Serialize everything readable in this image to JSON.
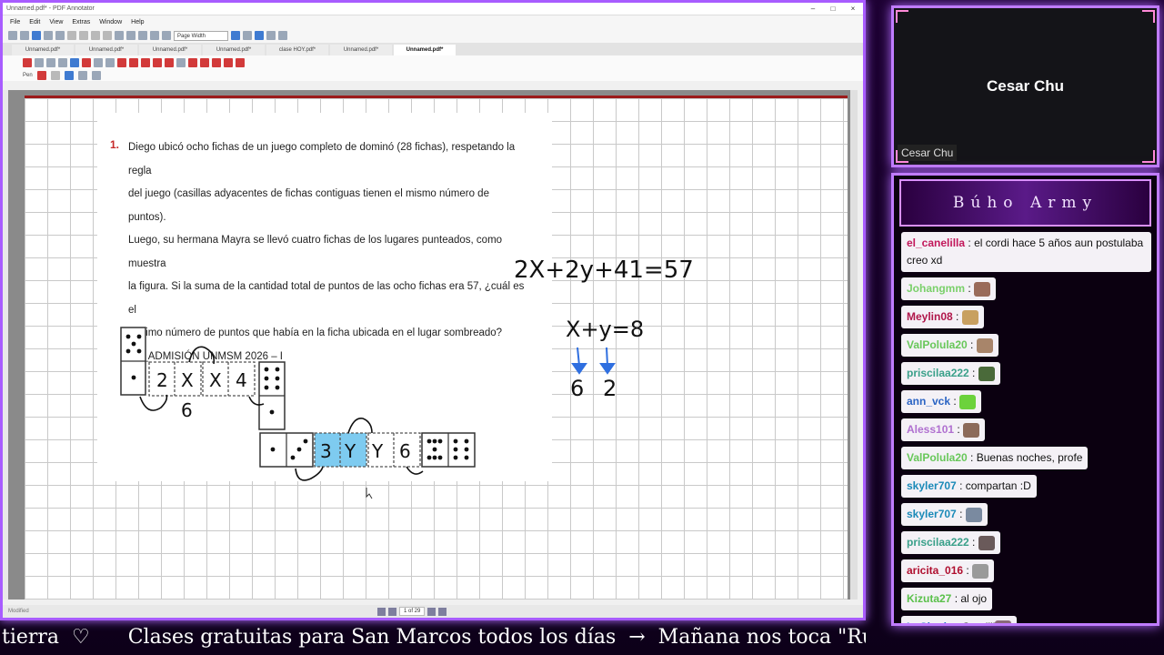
{
  "window": {
    "title": "Unnamed.pdf* - PDF Annotator",
    "controls": [
      "–",
      "□",
      "×"
    ]
  },
  "menu": [
    "File",
    "Edit",
    "View",
    "Extras",
    "Window",
    "Help"
  ],
  "zoom": "Page Width",
  "tabs": [
    "Unnamed.pdf*",
    "Unnamed.pdf*",
    "Unnamed.pdf*",
    "Unnamed.pdf*",
    "clase HOY.pdf*",
    "Unnamed.pdf*",
    "Unnamed.pdf*"
  ],
  "active_tab_index": 6,
  "pen_label": "Pen",
  "problem": {
    "number": "1.",
    "lines": [
      "Diego ubicó ocho fichas de un juego completo de dominó (28 fichas), respetando la regla",
      "del juego (casillas adyacentes de fichas contiguas tienen el mismo número de puntos).",
      "Luego, su hermana Mayra se llevó cuatro fichas de los lugares punteados, como muestra",
      "la figura. Si la suma de la cantidad total de puntos de las ocho fichas era 57, ¿cuál es el",
      "mínimo número de puntos que había en la ficha ubicada en el lugar sombreado?",
      "EX_ADMISIÓN UNMSM 2026 – I"
    ]
  },
  "handwriting": {
    "eq1": "2X+2y+41=57",
    "eq2": "X+y=8",
    "ans_left": "6",
    "ans_right": "2",
    "dom_labels": [
      "2",
      "X",
      "X",
      "4",
      "6",
      "3",
      "Y",
      "Y",
      "6"
    ]
  },
  "statusbar": {
    "left": "Modified",
    "page": "1 of 29"
  },
  "webcam": {
    "name": "Cesar Chu",
    "label": "Cesar Chu"
  },
  "chat": {
    "title": "Búho Army",
    "messages": [
      {
        "user": "el_canelilla",
        "color": "#c2185b",
        "text": "el cordi hace 5 años aun postulaba creo xd",
        "emote": ""
      },
      {
        "user": "Johangmm",
        "color": "#7ad06a",
        "text": "",
        "emote": "#9a6b5a"
      },
      {
        "user": "Meylin08",
        "color": "#b0164a",
        "text": "",
        "emote": "#c8a060"
      },
      {
        "user": "ValPolula20",
        "color": "#68c75a",
        "text": "",
        "emote": "#a8856a"
      },
      {
        "user": "priscilaa222",
        "color": "#3aa08a",
        "text": "",
        "emote": "#4a6a3a"
      },
      {
        "user": "ann_vck",
        "color": "#2b64c4",
        "text": "",
        "emote": "#6cd23c"
      },
      {
        "user": "Aless101",
        "color": "#b070d0",
        "text": "",
        "emote": "#8c6a5a"
      },
      {
        "user": "ValPolula20",
        "color": "#68c75a",
        "text": "Buenas noches, profe",
        "emote": ""
      },
      {
        "user": "skyler707",
        "color": "#1b8ab8",
        "text": "compartan :D",
        "emote": ""
      },
      {
        "user": "skyler707",
        "color": "#1b8ab8",
        "text": "",
        "emote": "#7a8aa0"
      },
      {
        "user": "priscilaa222",
        "color": "#3aa08a",
        "text": "",
        "emote": "#6a5a5a"
      },
      {
        "user": "aricita_016",
        "color": "#b01030",
        "text": "",
        "emote": "#9a9a9a"
      },
      {
        "user": "Kizuta27",
        "color": "#5ac04a",
        "text": "al ojo",
        "emote": ""
      },
      {
        "user": "LuShady",
        "color": "#2470c8",
        "text": "Omaiiii",
        "emote": "#8a6a7a"
      }
    ]
  },
  "ticker": "tierra  ♡      Clases gratuitas para San Marcos todos los días  →  Mañana nos toca \"Ruedas"
}
